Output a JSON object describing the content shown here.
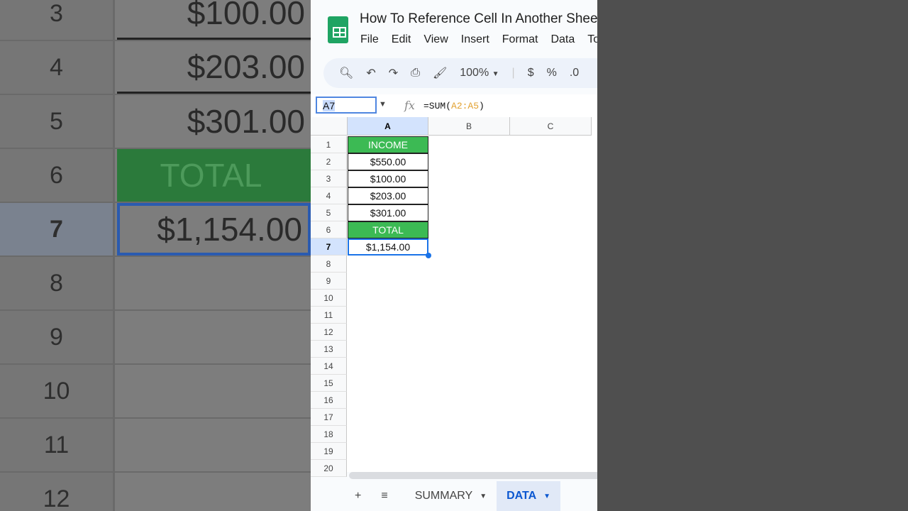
{
  "background": {
    "rows": [
      {
        "n": "3",
        "v": "$100.00"
      },
      {
        "n": "4",
        "v": "$203.00"
      },
      {
        "n": "5",
        "v": "$301.00"
      },
      {
        "n": "6",
        "v": "TOTAL"
      },
      {
        "n": "7",
        "v": "$1,154.00"
      },
      {
        "n": "8",
        "v": ""
      },
      {
        "n": "9",
        "v": ""
      },
      {
        "n": "10",
        "v": ""
      },
      {
        "n": "11",
        "v": ""
      },
      {
        "n": "12",
        "v": ""
      }
    ]
  },
  "app": {
    "title": "How To Reference Cell In Another Sheet",
    "menu": [
      "File",
      "Edit",
      "View",
      "Insert",
      "Format",
      "Data",
      "Tools"
    ],
    "toolbar": {
      "zoom": "100%",
      "currency": "$",
      "percent": "%",
      "decimal": ".0"
    },
    "namebox": "A7",
    "fx": "fx",
    "formula": {
      "prefix": "=SUM(",
      "ref": "A2:A5",
      "suffix": ")"
    },
    "columns": [
      "A",
      "B",
      "C"
    ],
    "rows": [
      "1",
      "2",
      "3",
      "4",
      "5",
      "6",
      "7",
      "8",
      "9",
      "10",
      "11",
      "12",
      "13",
      "14",
      "15",
      "16",
      "17",
      "18",
      "19",
      "20"
    ],
    "cells": [
      "INCOME",
      "$550.00",
      "$100.00",
      "$203.00",
      "$301.00",
      "TOTAL",
      "$1,154.00"
    ],
    "sheets": {
      "add": "+",
      "list": "≡",
      "tabs": [
        "SUMMARY",
        "DATA"
      ],
      "active": "DATA"
    }
  }
}
